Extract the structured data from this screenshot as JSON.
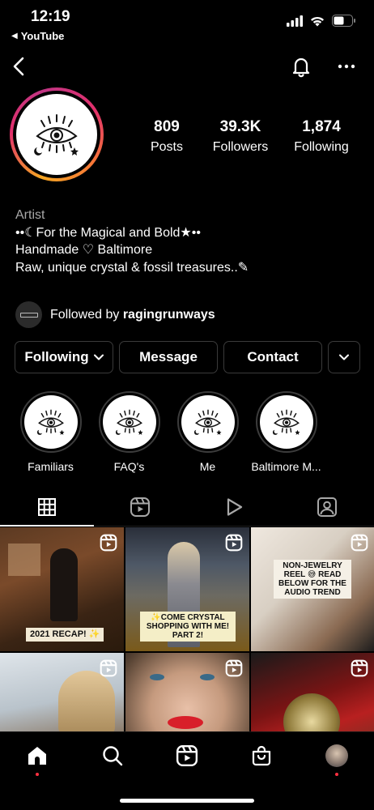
{
  "status_bar": {
    "time": "12:19",
    "back_app": "YouTube",
    "icons": [
      "signal-icon",
      "wifi-icon",
      "battery-icon"
    ]
  },
  "nav": {
    "icons": [
      "back-chevron-icon",
      "bell-icon",
      "more-horizontal-icon"
    ]
  },
  "profile": {
    "stats": [
      {
        "value": "809",
        "label": "Posts"
      },
      {
        "value": "39.3K",
        "label": "Followers"
      },
      {
        "value": "1,874",
        "label": "Following"
      }
    ],
    "category": "Artist",
    "bio_lines": [
      "••☾For the Magical and Bold★••",
      "Handmade ♡ Baltimore",
      "Raw, unique crystal & fossil treasures..✎"
    ],
    "followed_by_prefix": "Followed by ",
    "followed_by_user": "ragingrunways"
  },
  "actions": {
    "following": "Following",
    "message": "Message",
    "contact": "Contact"
  },
  "highlights": [
    {
      "label": "Familiars"
    },
    {
      "label": "FAQ's"
    },
    {
      "label": "Me"
    },
    {
      "label": "Baltimore M..."
    }
  ],
  "tabs": [
    "grid-icon",
    "reels-icon",
    "video-play-icon",
    "tagged-icon"
  ],
  "grid": [
    {
      "caption": "2021 RECAP! ✨"
    },
    {
      "caption": "✨COME CRYSTAL SHOPPING WITH ME! PART 2!"
    },
    {
      "caption": "NON-JEWELRY REEL 😅 READ BELOW FOR THE AUDIO TREND"
    },
    {
      "caption": ""
    },
    {
      "caption": ""
    },
    {
      "caption": ""
    }
  ],
  "bottom_nav": [
    "home-icon",
    "search-icon",
    "reels-icon",
    "shop-icon",
    "profile-avatar-icon"
  ]
}
